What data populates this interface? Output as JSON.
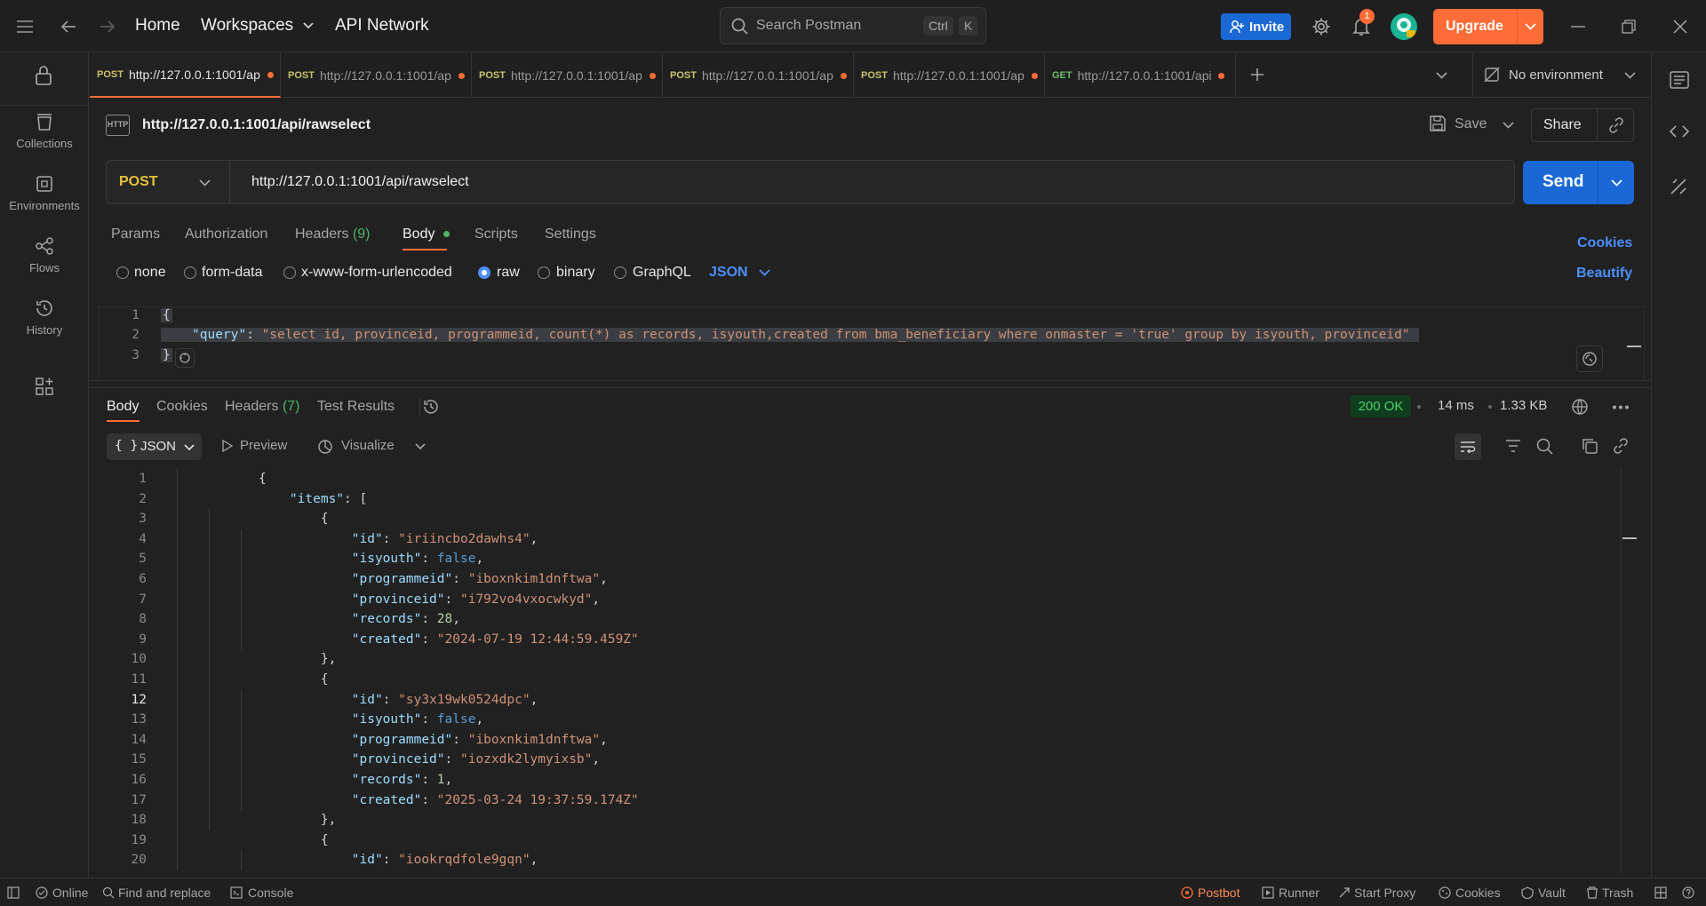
{
  "topbar": {
    "home": "Home",
    "workspaces": "Workspaces",
    "api_network": "API Network",
    "search_placeholder": "Search Postman",
    "kbd_ctrl": "Ctrl",
    "kbd_k": "K",
    "invite": "Invite",
    "notification_count": "1",
    "upgrade": "Upgrade"
  },
  "sidebar": {
    "items": [
      {
        "label": "Collections",
        "icon": "collections-icon"
      },
      {
        "label": "Environments",
        "icon": "environments-icon"
      },
      {
        "label": "Flows",
        "icon": "flows-icon"
      },
      {
        "label": "History",
        "icon": "history-icon"
      }
    ]
  },
  "tabs": [
    {
      "method": "POST",
      "url": "http://127.0.0.1:1001/ap"
    },
    {
      "method": "POST",
      "url": "http://127.0.0.1:1001/ap"
    },
    {
      "method": "POST",
      "url": "http://127.0.0.1:1001/ap"
    },
    {
      "method": "POST",
      "url": "http://127.0.0.1:1001/ap"
    },
    {
      "method": "POST",
      "url": "http://127.0.0.1:1001/ap"
    },
    {
      "method": "GET",
      "url": "http://127.0.0.1:1001/api,"
    }
  ],
  "environment": "No environment",
  "request": {
    "title": "http://127.0.0.1:1001/api/rawselect",
    "save": "Save",
    "share": "Share",
    "method": "POST",
    "url": "http://127.0.0.1:1001/api/rawselect",
    "send": "Send",
    "tabs": {
      "params": "Params",
      "authorization": "Authorization",
      "headers": "Headers",
      "headers_count": "(9)",
      "body": "Body",
      "scripts": "Scripts",
      "settings": "Settings"
    },
    "cookies": "Cookies",
    "beautify": "Beautify",
    "body_types": {
      "none": "none",
      "form_data": "form-data",
      "urlencoded": "x-www-form-urlencoded",
      "raw": "raw",
      "binary": "binary",
      "graphql": "GraphQL",
      "language": "JSON"
    },
    "body_lines": {
      "l1": "{",
      "l2_key": "\"query\"",
      "l2_colon": ": ",
      "l2_value": "\"select id, provinceid, programmeid, count(*) as records, isyouth,created from bma_beneficiary where onmaster = 'true' group by isyouth, provinceid\"",
      "l3": "}"
    }
  },
  "response": {
    "tabs": {
      "body": "Body",
      "cookies": "Cookies",
      "headers": "Headers",
      "headers_count": "(7)",
      "test_results": "Test Results"
    },
    "status": "200 OK",
    "time": "14 ms",
    "size": "1.33 KB",
    "format": "JSON",
    "preview": "Preview",
    "visualize": "Visualize",
    "lines": [
      {
        "no": "1",
        "t": [
          [
            "p",
            "{"
          ]
        ]
      },
      {
        "no": "2",
        "t": [
          [
            "k",
            "    \"items\""
          ],
          [
            "p",
            ": ["
          ]
        ]
      },
      {
        "no": "3",
        "t": [
          [
            "p",
            "        {"
          ]
        ]
      },
      {
        "no": "4",
        "t": [
          [
            "k",
            "            \"id\""
          ],
          [
            "p",
            ": "
          ],
          [
            "s",
            "\"iriincbo2dawhs4\""
          ],
          [
            "p",
            ","
          ]
        ]
      },
      {
        "no": "5",
        "t": [
          [
            "k",
            "            \"isyouth\""
          ],
          [
            "p",
            ": "
          ],
          [
            "b",
            "false"
          ],
          [
            "p",
            ","
          ]
        ]
      },
      {
        "no": "6",
        "t": [
          [
            "k",
            "            \"programmeid\""
          ],
          [
            "p",
            ": "
          ],
          [
            "s",
            "\"iboxnkim1dnftwa\""
          ],
          [
            "p",
            ","
          ]
        ]
      },
      {
        "no": "7",
        "t": [
          [
            "k",
            "            \"provinceid\""
          ],
          [
            "p",
            ": "
          ],
          [
            "s",
            "\"i792vo4vxocwkyd\""
          ],
          [
            "p",
            ","
          ]
        ]
      },
      {
        "no": "8",
        "t": [
          [
            "k",
            "            \"records\""
          ],
          [
            "p",
            ": "
          ],
          [
            "n",
            "28"
          ],
          [
            "p",
            ","
          ]
        ]
      },
      {
        "no": "9",
        "t": [
          [
            "k",
            "            \"created\""
          ],
          [
            "p",
            ": "
          ],
          [
            "s",
            "\"2024-07-19 12:44:59.459Z\""
          ]
        ]
      },
      {
        "no": "10",
        "t": [
          [
            "p",
            "        },"
          ]
        ]
      },
      {
        "no": "11",
        "t": [
          [
            "p",
            "        {"
          ]
        ]
      },
      {
        "no": "12",
        "t": [
          [
            "k",
            "            \"id\""
          ],
          [
            "p",
            ": "
          ],
          [
            "s",
            "\"sy3x19wk0524dpc\""
          ],
          [
            "p",
            ","
          ]
        ]
      },
      {
        "no": "13",
        "t": [
          [
            "k",
            "            \"isyouth\""
          ],
          [
            "p",
            ": "
          ],
          [
            "b",
            "false"
          ],
          [
            "p",
            ","
          ]
        ]
      },
      {
        "no": "14",
        "t": [
          [
            "k",
            "            \"programmeid\""
          ],
          [
            "p",
            ": "
          ],
          [
            "s",
            "\"iboxnkim1dnftwa\""
          ],
          [
            "p",
            ","
          ]
        ]
      },
      {
        "no": "15",
        "t": [
          [
            "k",
            "            \"provinceid\""
          ],
          [
            "p",
            ": "
          ],
          [
            "s",
            "\"iozxdk2lymyixsb\""
          ],
          [
            "p",
            ","
          ]
        ]
      },
      {
        "no": "16",
        "t": [
          [
            "k",
            "            \"records\""
          ],
          [
            "p",
            ": "
          ],
          [
            "n",
            "1"
          ],
          [
            "p",
            ","
          ]
        ]
      },
      {
        "no": "17",
        "t": [
          [
            "k",
            "            \"created\""
          ],
          [
            "p",
            ": "
          ],
          [
            "s",
            "\"2025-03-24 19:37:59.174Z\""
          ]
        ]
      },
      {
        "no": "18",
        "t": [
          [
            "p",
            "        },"
          ]
        ]
      },
      {
        "no": "19",
        "t": [
          [
            "p",
            "        {"
          ]
        ]
      },
      {
        "no": "20",
        "t": [
          [
            "k",
            "            \"id\""
          ],
          [
            "p",
            ": "
          ],
          [
            "s",
            "\"iookrqdfole9gqn\""
          ],
          [
            "p",
            ","
          ]
        ]
      }
    ]
  },
  "statusbar": {
    "online": "Online",
    "find_replace": "Find and replace",
    "console": "Console",
    "postbot": "Postbot",
    "runner": "Runner",
    "start_proxy": "Start Proxy",
    "cookies": "Cookies",
    "vault": "Vault",
    "trash": "Trash"
  },
  "colors": {
    "accent": "#ff6c37",
    "primary": "#1a68d6",
    "status_ok": "#2f9e44"
  }
}
